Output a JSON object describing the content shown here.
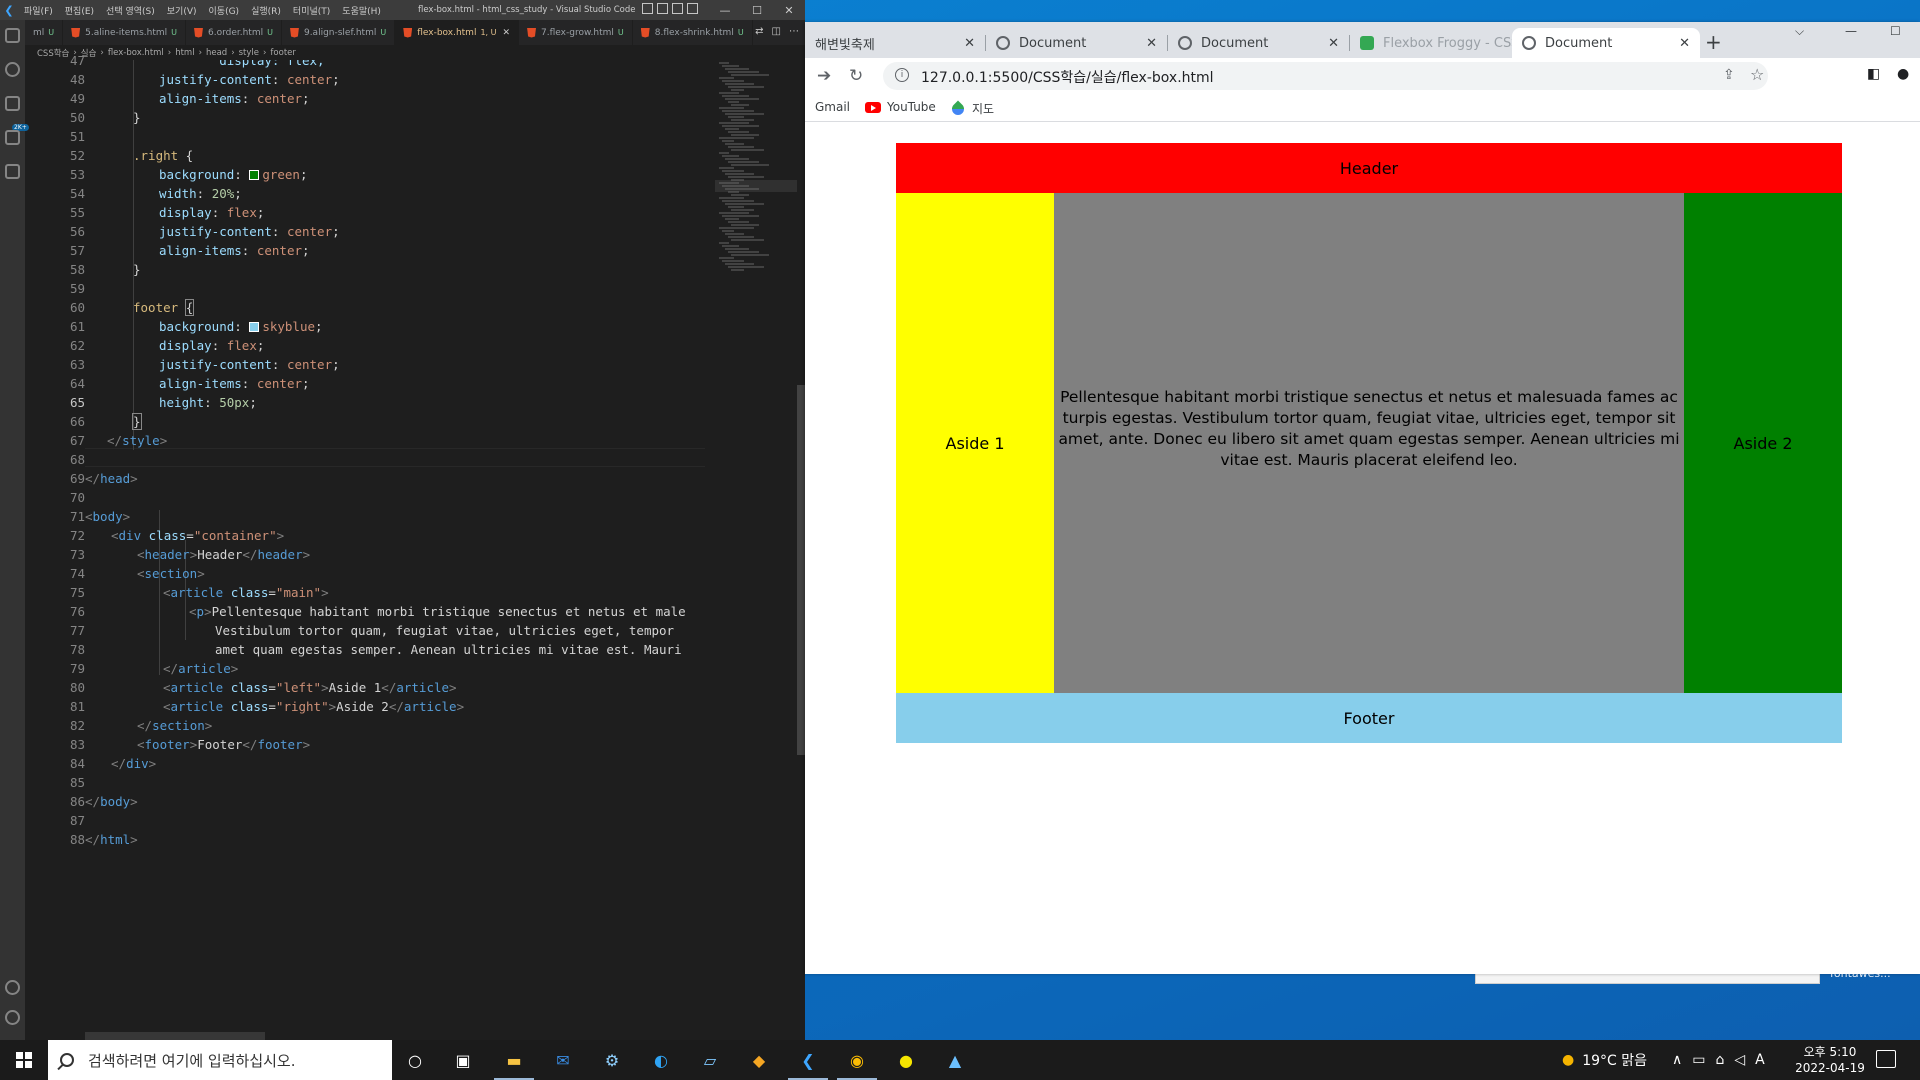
{
  "vscode": {
    "menu": [
      "파일(F)",
      "편집(E)",
      "선택 영역(S)",
      "보기(V)",
      "이동(G)",
      "실행(R)",
      "터미널(T)",
      "도움말(H)"
    ],
    "window_title": "flex-box.html - html_css_study - Visual Studio Code",
    "tabs": [
      {
        "label": "ml",
        "mod": "U"
      },
      {
        "label": "5.aline-items.html",
        "mod": "U"
      },
      {
        "label": "6.order.html",
        "mod": "U"
      },
      {
        "label": "9.align-slef.html",
        "mod": "U"
      },
      {
        "label": "flex-box.html",
        "mod": "1, U",
        "active": true
      },
      {
        "label": "7.flex-grow.html",
        "mod": "U"
      },
      {
        "label": "8.flex-shrink.html",
        "mod": "U"
      }
    ],
    "breadcrumb": [
      "CSS학습",
      "실습",
      "flex-box.html",
      "html",
      "head",
      "style",
      "footer"
    ],
    "line_numbers": [
      "47",
      "48",
      "49",
      "50",
      "51",
      "52",
      "53",
      "54",
      "55",
      "56",
      "57",
      "58",
      "59",
      "60",
      "61",
      "62",
      "63",
      "64",
      "65",
      "66",
      "67",
      "68",
      "69",
      "70",
      "71",
      "72",
      "73",
      "74",
      "75",
      "76",
      "77",
      "78",
      "79",
      "80",
      "81",
      "82",
      "83",
      "84",
      "85",
      "86",
      "87",
      "88"
    ],
    "current_line": "65",
    "code": {
      "l47": "        display: flex;",
      "l48a": "        ",
      "l48p": "justify-content",
      "l48v": "center",
      "l49p": "align-items",
      "l49v": "center",
      "l50": "}",
      "l52s": ".right",
      "l53p": "background",
      "l53v": "green",
      "l54p": "width",
      "l54v": "20%",
      "l55p": "display",
      "l55v": "flex",
      "l56p": "justify-content",
      "l56v": "center",
      "l57p": "align-items",
      "l57v": "center",
      "l58": "}",
      "l60s": "footer",
      "l61p": "background",
      "l61v": "skyblue",
      "l62p": "display",
      "l62v": "flex",
      "l63p": "justify-content",
      "l63v": "center",
      "l64p": "align-items",
      "l64v": "center",
      "l65p": "height",
      "l65v": "50px",
      "l66": "}",
      "l67": "style",
      "l69": "head",
      "l71": "body",
      "l72t": "div",
      "l72a": "class",
      "l72v": "\"container\"",
      "l73t": "header",
      "l73x": "Header",
      "l74t": "section",
      "l75t": "article",
      "l75a": "class",
      "l75v": "\"main\"",
      "l76t": "p",
      "l76x": "Pellentesque habitant morbi tristique senectus et netus et male",
      "l77x": "Vestibulum tortor quam, feugiat vitae, ultricies eget, tempor",
      "l78x": "amet quam egestas semper. Aenean ultricies mi vitae est. Mauri",
      "l79t": "article",
      "l80t": "article",
      "l80a": "class",
      "l80v": "\"left\"",
      "l80x": "Aside 1",
      "l81t": "article",
      "l81a": "class",
      "l81v": "\"right\"",
      "l81x": "Aside 2",
      "l82t": "section",
      "l83t": "footer",
      "l83x": "Footer",
      "l84t": "div",
      "l86t": "body",
      "l88t": "html"
    },
    "colors": {
      "green": "#008000",
      "skyblue": "#87ceeb"
    }
  },
  "browser": {
    "tabs": [
      {
        "label": "해변빛축제"
      },
      {
        "label": "Document"
      },
      {
        "label": "Document"
      },
      {
        "label": "Flexbox Froggy - CSS"
      },
      {
        "label": "Document",
        "active": true
      }
    ],
    "new_tab": "+",
    "url": "127.0.0.1:5500/CSS학습/실습/flex-box.html",
    "bookmarks": [
      "Gmail",
      "YouTube",
      "지도"
    ],
    "page": {
      "header": "Header",
      "main_text": "Pellentesque habitant morbi tristique senectus et netus et malesuada fames ac turpis egestas. Vestibulum tortor quam, feugiat vitae, ultricies eget, tempor sit amet, ante. Donec eu libero sit amet quam egestas semper. Aenean ultricies mi vitae est. Mauris placerat eleifend leo.",
      "aside1": "Aside 1",
      "aside2": "Aside 2",
      "footer": "Footer",
      "colors": {
        "header": "#ff0000",
        "left": "#ffff00",
        "main": "#808080",
        "right": "#008000",
        "footer": "#87ceeb"
      }
    }
  },
  "desktop": {
    "partial_text": "fontawes..."
  },
  "taskbar": {
    "search_placeholder": "검색하려면 여기에 입력하십시오.",
    "weather": "19°C  맑음",
    "ime": "A",
    "time": "오후 5:10",
    "date": "2022-04-19"
  }
}
